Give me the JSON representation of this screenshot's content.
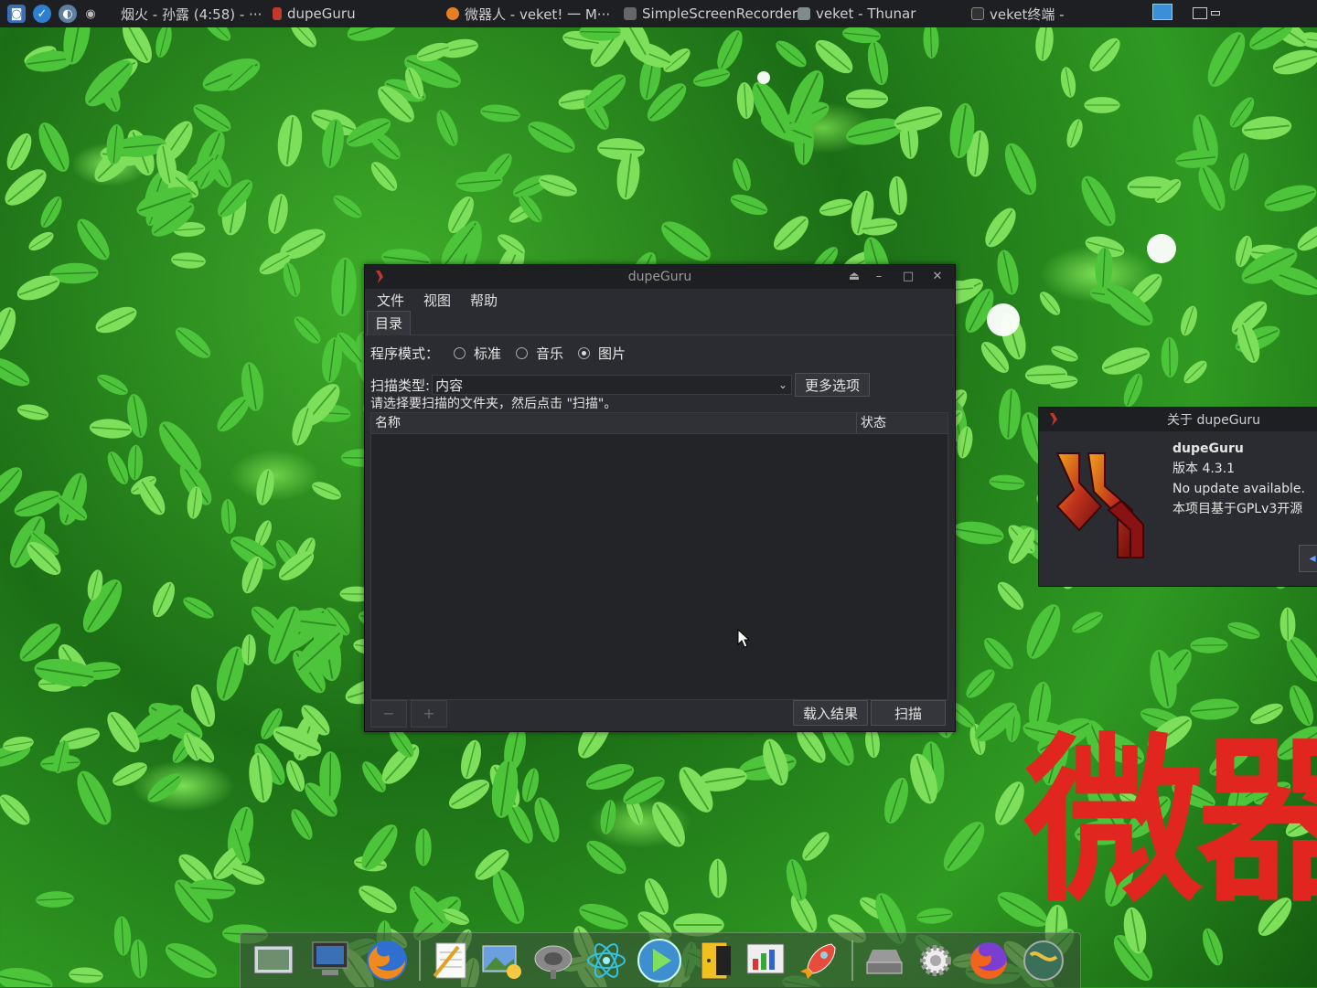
{
  "top_panel": {
    "tasks": [
      {
        "label": "烟火 - 孙露 (4:58) - ···",
        "color": "#8a8a8a"
      },
      {
        "label": "dupeGuru",
        "color": "#c0392b"
      },
      {
        "label": "微器人 - veket! 一 M···",
        "color": "#e67e22"
      },
      {
        "label": "SimpleScreenRecorder",
        "color": "#555555"
      },
      {
        "label": "veket - Thunar",
        "color": "#7f8c8d"
      },
      {
        "label": "veket终端 -",
        "color": "#444444"
      }
    ]
  },
  "main_window": {
    "title": "dupeGuru",
    "menu": [
      "文件",
      "视图",
      "帮助"
    ],
    "tab": "目录",
    "mode_label": "程序模式：",
    "modes": [
      {
        "label": "标准",
        "selected": false
      },
      {
        "label": "音乐",
        "selected": false
      },
      {
        "label": "图片",
        "selected": true
      }
    ],
    "scan_type_label": "扫描类型:",
    "scan_type_value": "内容",
    "more_options": "更多选项",
    "hint": "请选择要扫描的文件夹，然后点击 \"扫描\"。",
    "columns": [
      "名称",
      "状态"
    ],
    "remove_btn": "−",
    "add_btn": "+",
    "load_results": "载入结果",
    "scan": "扫描"
  },
  "about_dialog": {
    "title": "关于 dupeGuru",
    "app_name": "dupeGuru",
    "version": "版本 4.3.1",
    "update": "No update available.",
    "license": "本项目基于GPLv3开源"
  },
  "overlay_text": "微器"
}
